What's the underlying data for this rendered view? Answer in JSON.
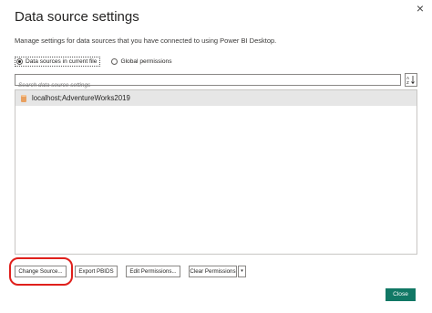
{
  "dialog": {
    "title": "Data source settings",
    "subtitle": "Manage settings for data sources that you have connected to using Power BI Desktop.",
    "close_glyph": "×"
  },
  "scope": {
    "options": [
      {
        "label": "Data sources in current file",
        "selected": true
      },
      {
        "label": "Global permissions",
        "selected": false
      }
    ]
  },
  "search": {
    "placeholder": "Search data source settings",
    "value": "",
    "sort_icon": "sort-az-icon"
  },
  "data_sources": [
    {
      "label": "localhost;AdventureWorks2019",
      "icon": "database-icon",
      "selected": true
    }
  ],
  "actions": {
    "change_source": "Change Source...",
    "export_pbids": "Export PBIDS",
    "edit_permissions": "Edit Permissions...",
    "clear_permissions": "Clear Permissions",
    "clear_dropdown_glyph": "▾"
  },
  "footer": {
    "close": "Close"
  },
  "colors": {
    "primary": "#117865",
    "annotation": "#e0201c",
    "selected_row": "#e6e6e6"
  }
}
